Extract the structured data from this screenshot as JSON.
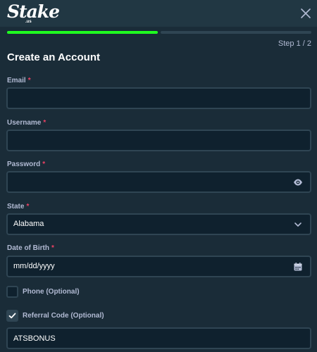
{
  "header": {
    "logo_text": "Stake",
    "logo_sub": ".us"
  },
  "progress": {
    "current_step": 1,
    "total_steps": 2,
    "step_text": "Step 1 / 2"
  },
  "form": {
    "title": "Create an Account",
    "required_marker": "*",
    "email": {
      "label": "Email",
      "value": ""
    },
    "username": {
      "label": "Username",
      "value": ""
    },
    "password": {
      "label": "Password",
      "value": "",
      "icon": "eye-icon"
    },
    "state": {
      "label": "State",
      "value": "Alabama",
      "icon": "chevron-down-icon"
    },
    "dob": {
      "label": "Date of Birth",
      "placeholder": "mm/dd/yyyy",
      "icon": "calendar-icon"
    },
    "phone": {
      "label": "Phone (Optional)",
      "checked": false
    },
    "referral": {
      "label": "Referral Code (Optional)",
      "checked": true,
      "value": "ATSBONUS"
    }
  },
  "colors": {
    "background": "#1a2c38",
    "header": "#213743",
    "input_bg": "#0f212e",
    "border": "#2f4553",
    "progress": "#1fff20",
    "label": "#b1bad3",
    "required": "#ed4163"
  }
}
